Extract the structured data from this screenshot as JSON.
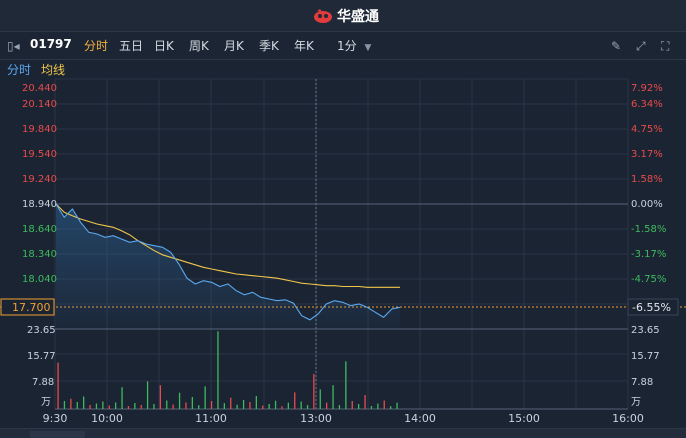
{
  "app": {
    "brand": "华盛通"
  },
  "toolbar": {
    "code": "01797",
    "periods": [
      "分时",
      "五日",
      "日K",
      "周K",
      "月K",
      "季K",
      "年K"
    ],
    "interval": "1分"
  },
  "legend": {
    "minute_label": "分时",
    "avg_label": "均线"
  },
  "price_axis": {
    "left_labels": [
      "20.440",
      "20.140",
      "19.840",
      "19.540",
      "19.240",
      "18.940",
      "18.640",
      "18.340",
      "18.040"
    ],
    "right_labels": [
      "7.92%",
      "6.34%",
      "4.75%",
      "3.17%",
      "1.58%",
      "0.00%",
      "-1.58%",
      "-3.17%",
      "-4.75%"
    ],
    "current_price": "17.700",
    "current_pct": "-6.55%"
  },
  "volume_axis": {
    "labels": [
      "23.65",
      "15.77",
      "7.88",
      "万"
    ]
  },
  "time_axis": {
    "labels": [
      "9:30",
      "10:00",
      "11:00",
      "13:00",
      "14:00",
      "15:00",
      "16:00"
    ]
  },
  "colors": {
    "price_line": "#5aa9f0",
    "avg_line": "#f0c64a",
    "up": "#e84b4b",
    "down": "#3dbb5c",
    "flat": "#d0d0d0",
    "active_tab": "#f5b041"
  },
  "chart_data": {
    "type": "line",
    "prev_close": 18.94,
    "ylim": [
      17.44,
      20.44
    ],
    "x_ticks": [
      "9:30",
      "10:00",
      "11:00",
      "13:00",
      "14:00",
      "15:00",
      "16:00"
    ],
    "series": [
      {
        "name": "分时",
        "values": [
          18.94,
          18.78,
          18.88,
          18.72,
          18.6,
          18.58,
          18.54,
          18.56,
          18.52,
          18.48,
          18.5,
          18.46,
          18.44,
          18.42,
          18.36,
          18.22,
          18.05,
          17.98,
          18.02,
          18.0,
          17.95,
          17.98,
          17.9,
          17.85,
          17.88,
          17.82,
          17.8,
          17.78,
          17.79,
          17.75,
          17.6,
          17.55,
          17.62,
          17.74,
          17.78,
          17.76,
          17.72,
          17.74,
          17.7,
          17.64,
          17.58,
          17.68,
          17.7
        ]
      },
      {
        "name": "均线",
        "values": [
          18.94,
          18.84,
          18.8,
          18.76,
          18.73,
          18.7,
          18.68,
          18.66,
          18.62,
          18.57,
          18.5,
          18.44,
          18.38,
          18.33,
          18.3,
          18.27,
          18.24,
          18.21,
          18.18,
          18.16,
          18.14,
          18.12,
          18.1,
          18.09,
          18.08,
          18.07,
          18.06,
          18.05,
          18.03,
          18.01,
          17.99,
          17.98,
          17.97,
          17.96,
          17.96,
          17.95,
          17.95,
          17.95,
          17.94,
          17.94,
          17.94,
          17.94,
          17.94
        ]
      }
    ],
    "volume": {
      "ymax": 31.5,
      "values": [
        18.5,
        3.2,
        4.1,
        2.8,
        5.0,
        1.6,
        2.2,
        3.0,
        1.4,
        2.6,
        8.7,
        1.2,
        2.4,
        1.6,
        11.0,
        2.0,
        9.5,
        3.4,
        1.8,
        6.5,
        2.6,
        4.8,
        1.5,
        9.0,
        3.2,
        31.0,
        2.3,
        4.5,
        1.7,
        3.6,
        2.8,
        5.2,
        1.4,
        2.0,
        3.3,
        1.1,
        2.5,
        6.6,
        3.0,
        1.6,
        14.0,
        7.8,
        2.5,
        9.5,
        1.6,
        19.0,
        3.2,
        2.0,
        5.6,
        1.2,
        2.2,
        3.4,
        1.1,
        2.5
      ],
      "dir": [
        "u",
        "d",
        "u",
        "d",
        "d",
        "u",
        "d",
        "d",
        "u",
        "d",
        "d",
        "u",
        "d",
        "u",
        "d",
        "d",
        "u",
        "d",
        "u",
        "d",
        "u",
        "d",
        "d",
        "d",
        "u",
        "d",
        "d",
        "u",
        "d",
        "d",
        "u",
        "d",
        "u",
        "d",
        "d",
        "u",
        "d",
        "u",
        "d",
        "d",
        "u",
        "d",
        "u",
        "d",
        "d",
        "d",
        "u",
        "d",
        "u",
        "d",
        "d",
        "u",
        "d",
        "d"
      ]
    }
  }
}
